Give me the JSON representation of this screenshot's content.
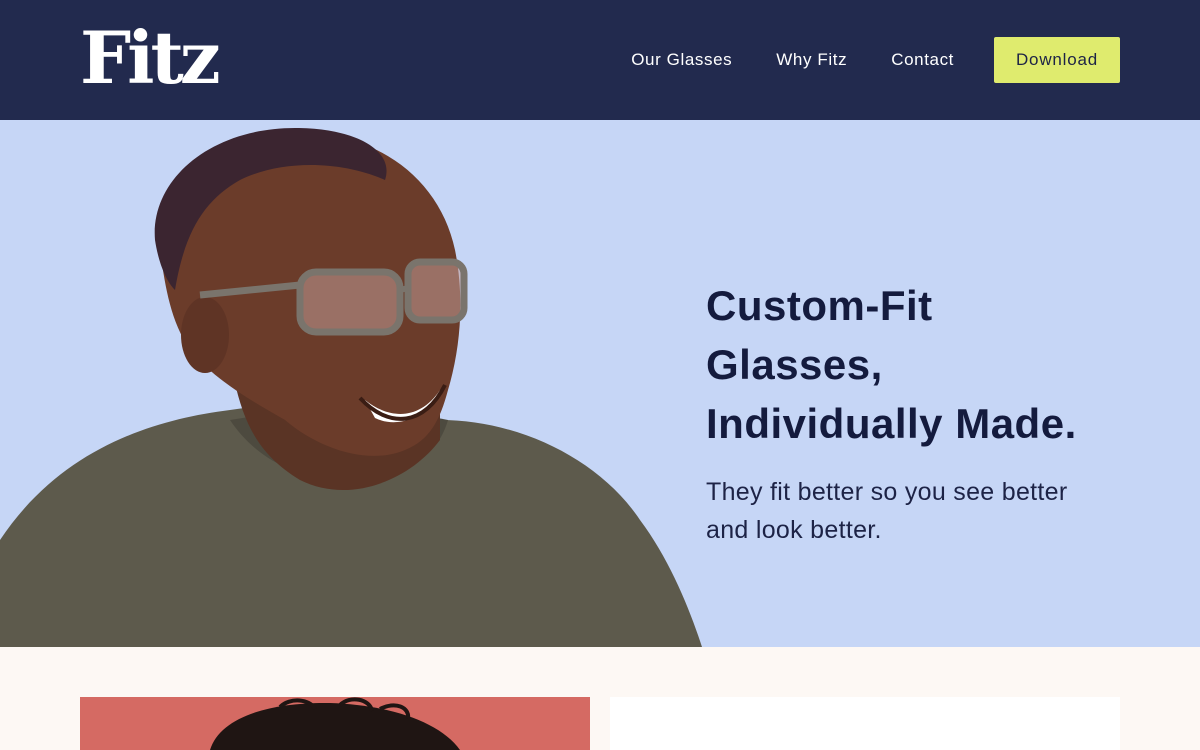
{
  "header": {
    "logo": "Fitz",
    "nav": [
      {
        "label": "Our Glasses"
      },
      {
        "label": "Why Fitz"
      },
      {
        "label": "Contact"
      }
    ],
    "download_label": "Download"
  },
  "hero": {
    "title_lines": [
      "Custom-Fit",
      "Glasses,",
      "Individually Made."
    ],
    "subtitle_lines": [
      "They fit better so you see better",
      "and look better."
    ]
  },
  "colors": {
    "header_bg": "#222a4e",
    "accent": "#dfeb6e",
    "hero_bg": "#c6d6f6",
    "text_dark": "#141b3e",
    "page_bg": "#fdf8f4",
    "card_coral": "#d56a63"
  }
}
